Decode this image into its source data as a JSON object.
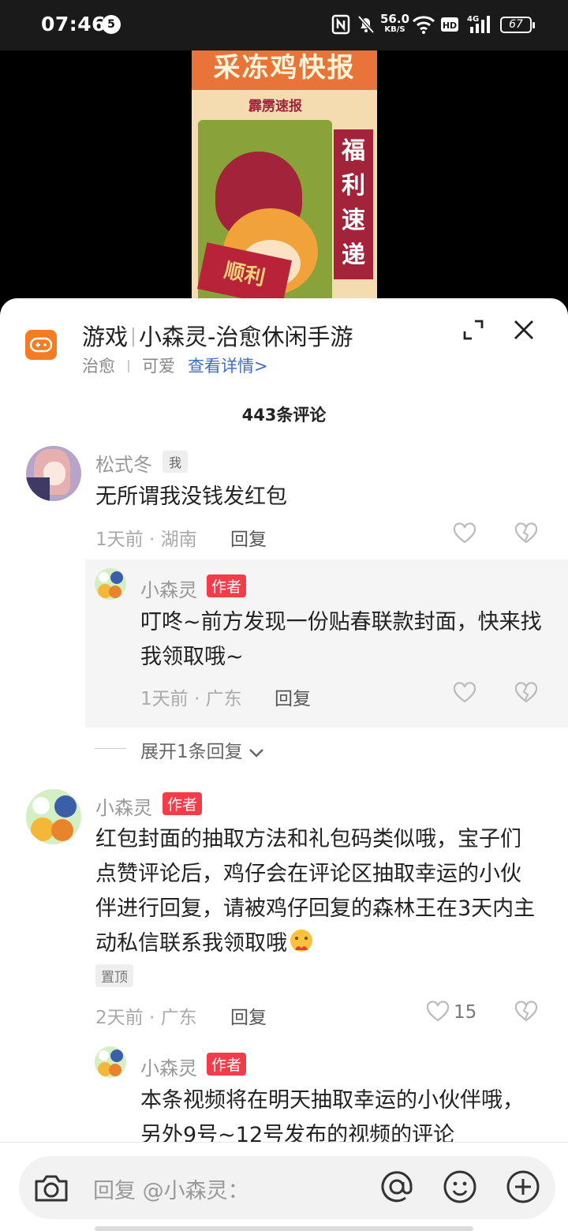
{
  "status_bar": {
    "time": "07:46",
    "notification_count": "5",
    "net_speed_value": "56.0",
    "net_speed_unit": "KB/S",
    "network_type": "4G",
    "battery": "67",
    "icons": [
      "nfc-icon",
      "mute-icon",
      "wifi-icon",
      "hd-icon",
      "signal-icon",
      "battery-icon"
    ]
  },
  "video_cover": {
    "title": "采冻鸡快报",
    "subtitle": "霹雳速报",
    "banner": "福利速递",
    "couplet": "顺利"
  },
  "header": {
    "category": "游戏",
    "game_name": "小森灵-治愈休闲手游",
    "tags": [
      "治愈",
      "可爱"
    ],
    "details_link": "查看详情>",
    "icons": [
      "game-controller-icon",
      "expand-icon",
      "close-icon"
    ],
    "accent_color": "#f57c22"
  },
  "comment_count": "443条评论",
  "comments": [
    {
      "author": "松式冬",
      "badge": "我",
      "text": "无所谓我没钱发红包",
      "time": "1天前 · 湖南",
      "reply_label": "回复",
      "likes": "",
      "replies": [
        {
          "author": "小森灵",
          "badge": "作者",
          "text": "叮咚~前方发现一份贴春联款封面，快来找我领取哦~",
          "time": "1天前 · 广东",
          "reply_label": "回复"
        }
      ],
      "expand_label": "展开1条回复"
    },
    {
      "author": "小森灵",
      "badge": "作者",
      "text": "红包封面的抽取方法和礼包码类似哦，宝子们点赞评论后，鸡仔会在评论区抽取幸运的小伙伴进行回复，请被鸡仔回复的森林王在3天内主动私信联系我领取哦",
      "pinned_label": "置顶",
      "time": "2天前 · 广东",
      "reply_label": "回复",
      "likes": "15",
      "replies": [
        {
          "author": "小森灵",
          "badge": "作者",
          "text": "本条视频将在明天抽取幸运的小伙伴哦，另外9号~12号发布的视频的评论"
        }
      ]
    }
  ],
  "input": {
    "placeholder": "回复 @小森灵：",
    "icons": [
      "camera-icon",
      "at-icon",
      "emoji-icon",
      "plus-icon"
    ]
  },
  "colors": {
    "author_badge": "#f23c4a",
    "link": "#3d6fc4"
  }
}
